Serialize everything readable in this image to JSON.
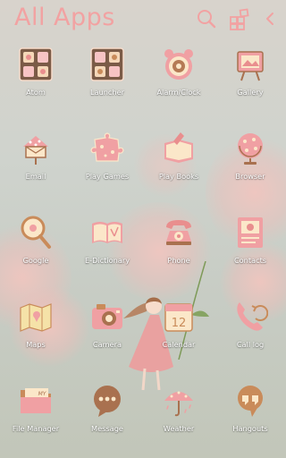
{
  "header": {
    "title": "All Apps",
    "icons": [
      "search-icon",
      "widgets-icon",
      "back-icon"
    ]
  },
  "apps": [
    {
      "label": "Atom",
      "icon": "atom-icon"
    },
    {
      "label": "Launcher",
      "icon": "launcher-icon"
    },
    {
      "label": "Alarm/Clock",
      "icon": "alarm-clock-icon"
    },
    {
      "label": "Gallery",
      "icon": "gallery-icon"
    },
    {
      "label": "Email",
      "icon": "email-icon"
    },
    {
      "label": "Play Games",
      "icon": "play-games-icon"
    },
    {
      "label": "Play Books",
      "icon": "play-books-icon"
    },
    {
      "label": "Browser",
      "icon": "browser-icon"
    },
    {
      "label": "Google",
      "icon": "google-icon"
    },
    {
      "label": "E-Dictionary",
      "icon": "e-dictionary-icon"
    },
    {
      "label": "Phone",
      "icon": "phone-icon"
    },
    {
      "label": "Contacts",
      "icon": "contacts-icon"
    },
    {
      "label": "Maps",
      "icon": "maps-icon"
    },
    {
      "label": "Camera",
      "icon": "camera-icon"
    },
    {
      "label": "Calendar",
      "icon": "calendar-icon"
    },
    {
      "label": "Call log",
      "icon": "call-log-icon"
    },
    {
      "label": "File Manager",
      "icon": "file-manager-icon"
    },
    {
      "label": "Message",
      "icon": "message-icon"
    },
    {
      "label": "Weather",
      "icon": "weather-icon"
    },
    {
      "label": "Hangouts",
      "icon": "hangouts-icon"
    }
  ],
  "calendar_icon_text": "12",
  "file_manager_icon_text": "MY",
  "colors": {
    "title": "#f2a2a2",
    "accent_pink": "#f0a0a3",
    "icon_brown": "#a9714f",
    "icon_cream": "#fbe7c9"
  }
}
